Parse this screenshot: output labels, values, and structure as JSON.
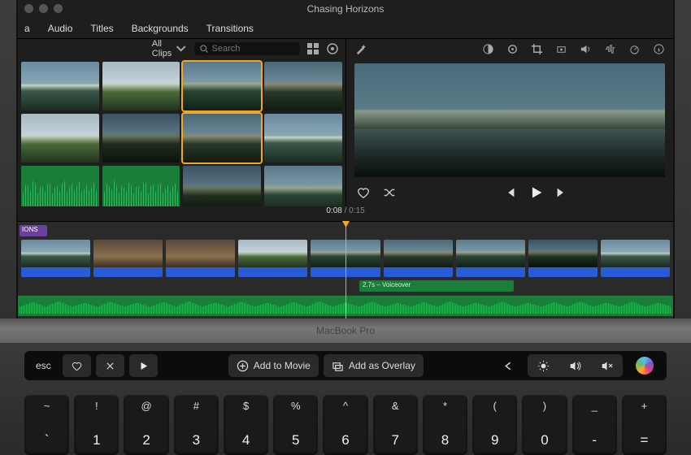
{
  "window": {
    "title": "Chasing Horizons"
  },
  "tabs": {
    "media": "a",
    "audio": "Audio",
    "titles": "Titles",
    "backgrounds": "Backgrounds",
    "transitions": "Transitions"
  },
  "browser": {
    "filter": "All Clips",
    "search_placeholder": "Search"
  },
  "timeline": {
    "current": "0:08",
    "total": "0:15",
    "voiceover_label": "2.7s – Voiceover"
  },
  "purple_clip_label": "IONS",
  "hinge_label": "MacBook Pro",
  "touchbar": {
    "esc": "esc",
    "add_movie": "Add to Movie",
    "add_overlay": "Add as Overlay"
  },
  "keys": [
    {
      "sym": "~",
      "num": "`"
    },
    {
      "sym": "!",
      "num": "1"
    },
    {
      "sym": "@",
      "num": "2"
    },
    {
      "sym": "#",
      "num": "3"
    },
    {
      "sym": "$",
      "num": "4"
    },
    {
      "sym": "%",
      "num": "5"
    },
    {
      "sym": "^",
      "num": "6"
    },
    {
      "sym": "&",
      "num": "7"
    },
    {
      "sym": "*",
      "num": "8"
    },
    {
      "sym": "(",
      "num": "9"
    },
    {
      "sym": ")",
      "num": "0"
    },
    {
      "sym": "_",
      "num": "-"
    },
    {
      "sym": "+",
      "num": "="
    }
  ]
}
